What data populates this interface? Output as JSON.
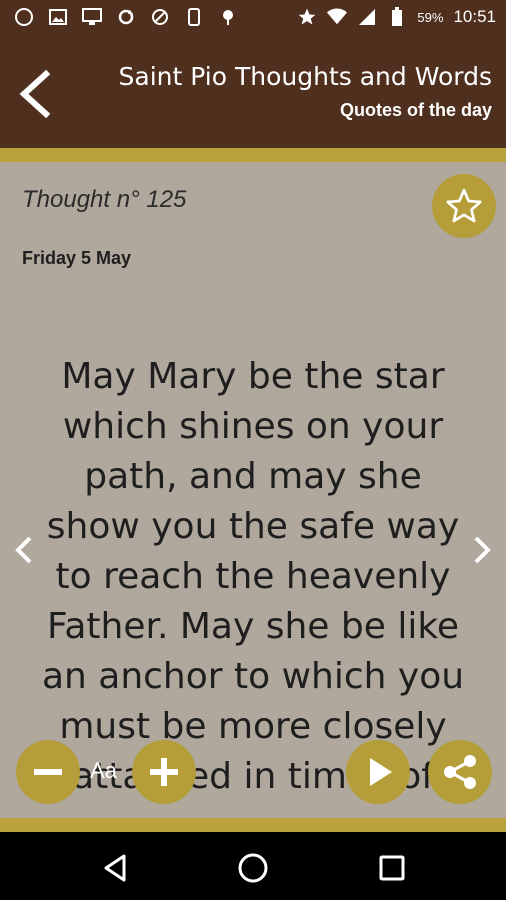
{
  "status": {
    "battery": "59%",
    "time": "10:51"
  },
  "appbar": {
    "title": "Saint Pio Thoughts and Words",
    "subtitle": "Quotes of the day"
  },
  "thought": {
    "number": "Thought n° 125",
    "date": "Friday 5 May",
    "text": "May Mary be the star which shines on your path, and may she show you the safe way to reach the heavenly Father. May she be like an anchor to which you must be more closely attached in times of"
  },
  "toolbar": {
    "font_label": "Aa"
  },
  "colors": {
    "header": "#4f2f1d",
    "gold": "#b9a23e",
    "background": "#b0a79d"
  }
}
